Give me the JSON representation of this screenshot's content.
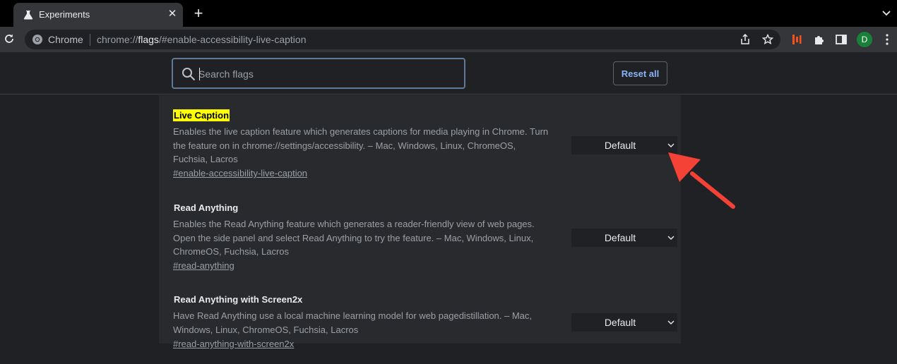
{
  "tab": {
    "title": "Experiments",
    "close_glyph": "✕",
    "new_tab_glyph": "+"
  },
  "omnibox": {
    "chip_label": "Chrome",
    "url_scheme": "chrome://",
    "url_host": "flags",
    "url_rest": "/#enable-accessibility-live-caption"
  },
  "profile": {
    "initial": "D",
    "color": "#188038"
  },
  "search": {
    "placeholder": "Search flags",
    "value": ""
  },
  "reset_label": "Reset all",
  "flags": [
    {
      "title": "Live Caption",
      "highlighted": true,
      "description": "Enables the live caption feature which generates captions for media playing in Chrome. Turn the feature on in chrome://settings/accessibility. – Mac, Windows, Linux, ChromeOS, Fuchsia, Lacros",
      "link": "#enable-accessibility-live-caption",
      "value": "Default"
    },
    {
      "title": "Read Anything",
      "highlighted": false,
      "description": "Enables the Read Anything feature which generates a reader-friendly view of web pages. Open the side panel and select Read Anything to try the feature. – Mac, Windows, Linux, ChromeOS, Fuchsia, Lacros",
      "link": "#read-anything",
      "value": "Default"
    },
    {
      "title": "Read Anything with Screen2x",
      "highlighted": false,
      "description": "Have Read Anything use a local machine learning model for web pagedistillation. – Mac, Windows, Linux, ChromeOS, Fuchsia, Lacros",
      "link": "#read-anything-with-screen2x",
      "value": "Default"
    }
  ],
  "colors": {
    "highlight": "#ffff00",
    "annotation_arrow": "#f44336",
    "accent": "#8ab4f8"
  }
}
